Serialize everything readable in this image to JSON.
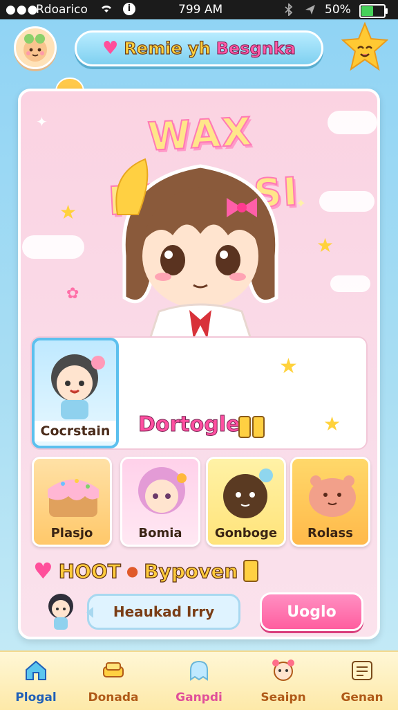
{
  "status_bar": {
    "carrier": "Rdoarico",
    "time": "799 AM",
    "battery": "50%",
    "battery_level": 0.5
  },
  "header": {
    "title_part1": "Remie yh",
    "title_part2": "Besgnka"
  },
  "hero": {
    "title": "WAX INDRASI"
  },
  "selected": {
    "mini_label": "Cocrstain",
    "name": "Dortogle"
  },
  "items": [
    {
      "label": "Plasjo"
    },
    {
      "label": "Bomia"
    },
    {
      "label": "Gonboge"
    },
    {
      "label": "Rolass"
    }
  ],
  "hoot": {
    "label": "HOOT",
    "label2": "Bypoven"
  },
  "speech": {
    "text": "Heaukad Irry"
  },
  "action": {
    "label": "Uoglo"
  },
  "nav": [
    {
      "label": "Plogal",
      "icon": "home-icon"
    },
    {
      "label": "Donada",
      "icon": "sofa-icon"
    },
    {
      "label": "Ganpdi",
      "icon": "ghost-icon"
    },
    {
      "label": "Seaipn",
      "icon": "face-icon"
    },
    {
      "label": "Genan",
      "icon": "menu-icon"
    }
  ],
  "colors": {
    "accent": "#ff5e9f",
    "sky": "#8fd3f4",
    "card_bg": "#fbd3e2",
    "nav_bg": "#fde9a8"
  }
}
